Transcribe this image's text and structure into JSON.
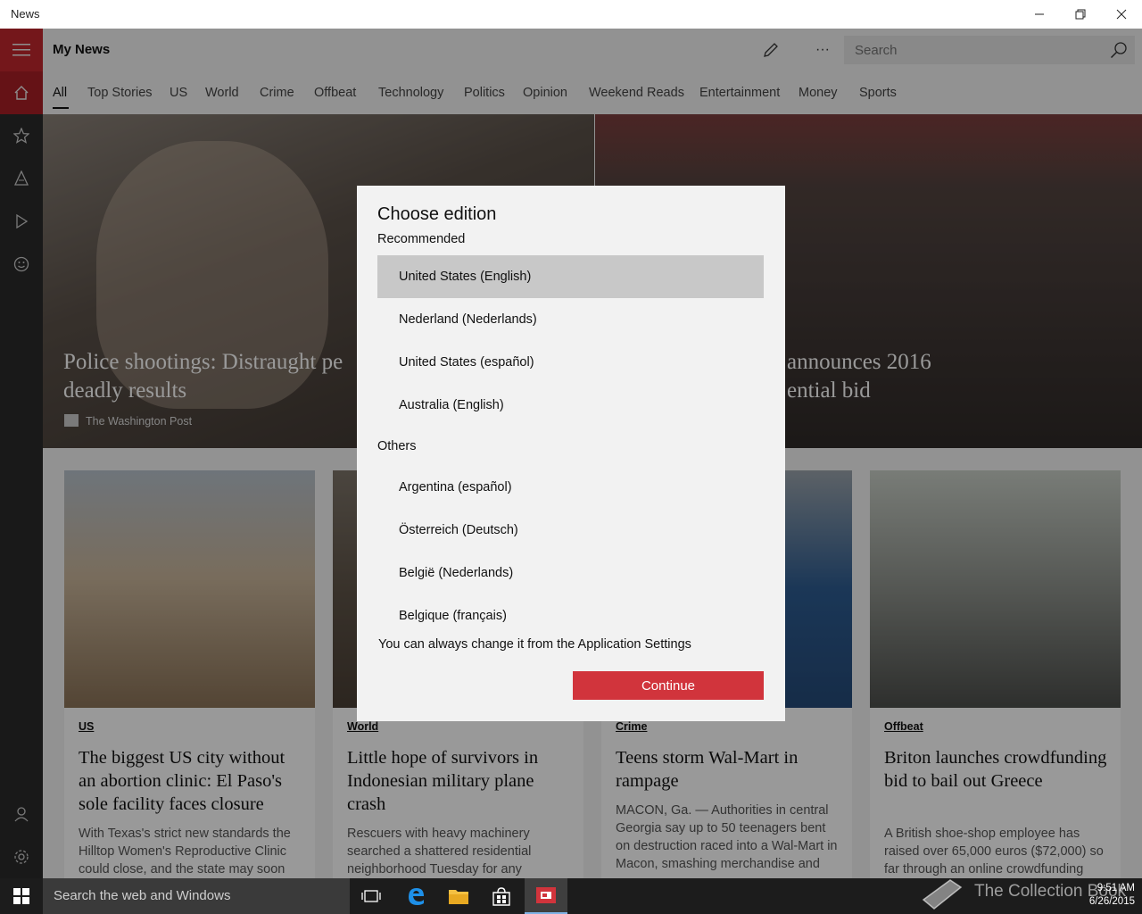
{
  "window": {
    "title": "News",
    "minimize": "—",
    "restore": "❐",
    "close": "✕"
  },
  "app": {
    "name": "My News",
    "more": "···",
    "search_placeholder": "Search",
    "accent_color": "#c1272d",
    "categories": [
      "All",
      "Top Stories",
      "US",
      "World",
      "Crime",
      "Offbeat",
      "Technology",
      "Politics",
      "Opinion",
      "Weekend Reads",
      "Entertainment",
      "Money",
      "Sports"
    ],
    "active_category": "All"
  },
  "hero": {
    "left": {
      "title": "Police shootings: Distraught pe deadly results",
      "line1": "Police shootings: Distraught pe",
      "line2": "deadly results",
      "source": "The Washington Post"
    },
    "right": {
      "line1": "announces 2016",
      "line2": "ential bid"
    }
  },
  "cards": [
    {
      "tag": "US",
      "headline": "The biggest US city without an abortion clinic: El Paso's sole facility faces closure",
      "snippet": "With Texas's strict new standards the Hilltop Women's Reproductive Clinic could close, and the state may soon"
    },
    {
      "tag": "World",
      "headline": "Little hope of survivors in Indonesian military plane crash",
      "snippet": "Rescuers with heavy machinery searched a shattered residential neighborhood Tuesday for any"
    },
    {
      "tag": "Crime",
      "headline": "Teens storm Wal-Mart in rampage",
      "snippet": "MACON, Ga. — Authorities in central Georgia say up to 50 teenagers bent on destruction raced into a Wal-Mart in Macon, smashing merchandise and"
    },
    {
      "tag": "Offbeat",
      "headline": "Briton launches crowdfunding bid to bail out Greece",
      "snippet": "A British shoe-shop employee has raised over 65,000 euros ($72,000) so far through an online crowdfunding"
    }
  ],
  "dialog": {
    "title": "Choose edition",
    "recommended_label": "Recommended",
    "recommended": [
      "United States (English)",
      "Nederland (Nederlands)",
      "United States (español)",
      "Australia (English)"
    ],
    "others_label": "Others",
    "others": [
      "Argentina (español)",
      "Österreich (Deutsch)",
      "België (Nederlands)",
      "Belgique (français)"
    ],
    "selected": "United States (English)",
    "note": "You can always change it from the Application Settings",
    "continue_label": "Continue",
    "button_color": "#d1343c"
  },
  "taskbar": {
    "search_placeholder": "Search the web and Windows",
    "watermark": "The Collection Book",
    "time": "9:51 AM",
    "date": "6/26/2015"
  }
}
